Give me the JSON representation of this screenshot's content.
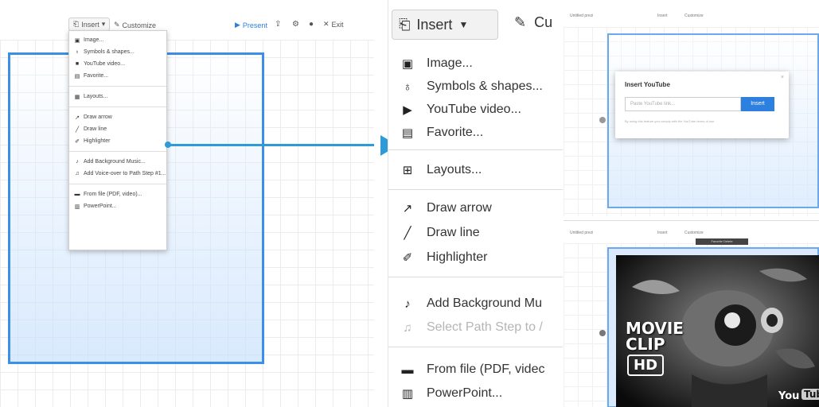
{
  "colors": {
    "accent": "#2d7fe0",
    "frame": "#3c8ee8",
    "arrow": "#2e9ad6"
  },
  "left": {
    "toolbar": {
      "insert": "Insert",
      "customize": "Customize",
      "present": "Present",
      "exit": "Exit"
    },
    "menu": {
      "image": "Image...",
      "symbols": "Symbols & shapes...",
      "youtube": "YouTube video...",
      "favorite": "Favorite...",
      "layouts": "Layouts...",
      "draw_arrow": "Draw arrow",
      "draw_line": "Draw line",
      "highlighter": "Highlighter",
      "bg_music": "Add Background Music...",
      "voice_over": "Add Voice-over to Path Step #1...",
      "from_file": "From file (PDF, video)...",
      "powerpoint": "PowerPoint..."
    }
  },
  "zoomed": {
    "toolbar": {
      "insert": "Insert",
      "customize": "Cu"
    },
    "menu": {
      "image": "Image...",
      "symbols": "Symbols & shapes...",
      "youtube": "YouTube video...",
      "favorite": "Favorite...",
      "layouts": "Layouts...",
      "draw_arrow": "Draw arrow",
      "draw_line": "Draw line",
      "highlighter": "Highlighter",
      "bg_music": "Add Background Mu",
      "select_path": "Select Path Step to /",
      "from_file": "From file (PDF, videc",
      "powerpoint": "PowerPoint..."
    }
  },
  "youtube_dialog": {
    "toolbar_title": "Untitled prezi",
    "toolbar_insert": "Insert",
    "toolbar_customize": "Customize",
    "title": "Insert YouTube",
    "close": "×",
    "placeholder": "Paste YouTube link...",
    "insert_button": "Insert",
    "help": "By using this feature you comply with the YouTube terms of use"
  },
  "video_view": {
    "toolbar_title": "Untitled prezi",
    "toolbar_insert": "Insert",
    "toolbar_customize": "Customize",
    "video_bar": "Favorite  Delete",
    "overlay_line1": "MOVIE",
    "overlay_line2": "CLIP",
    "hd": "HD",
    "logo_you": "You",
    "logo_tube": "Tube"
  }
}
